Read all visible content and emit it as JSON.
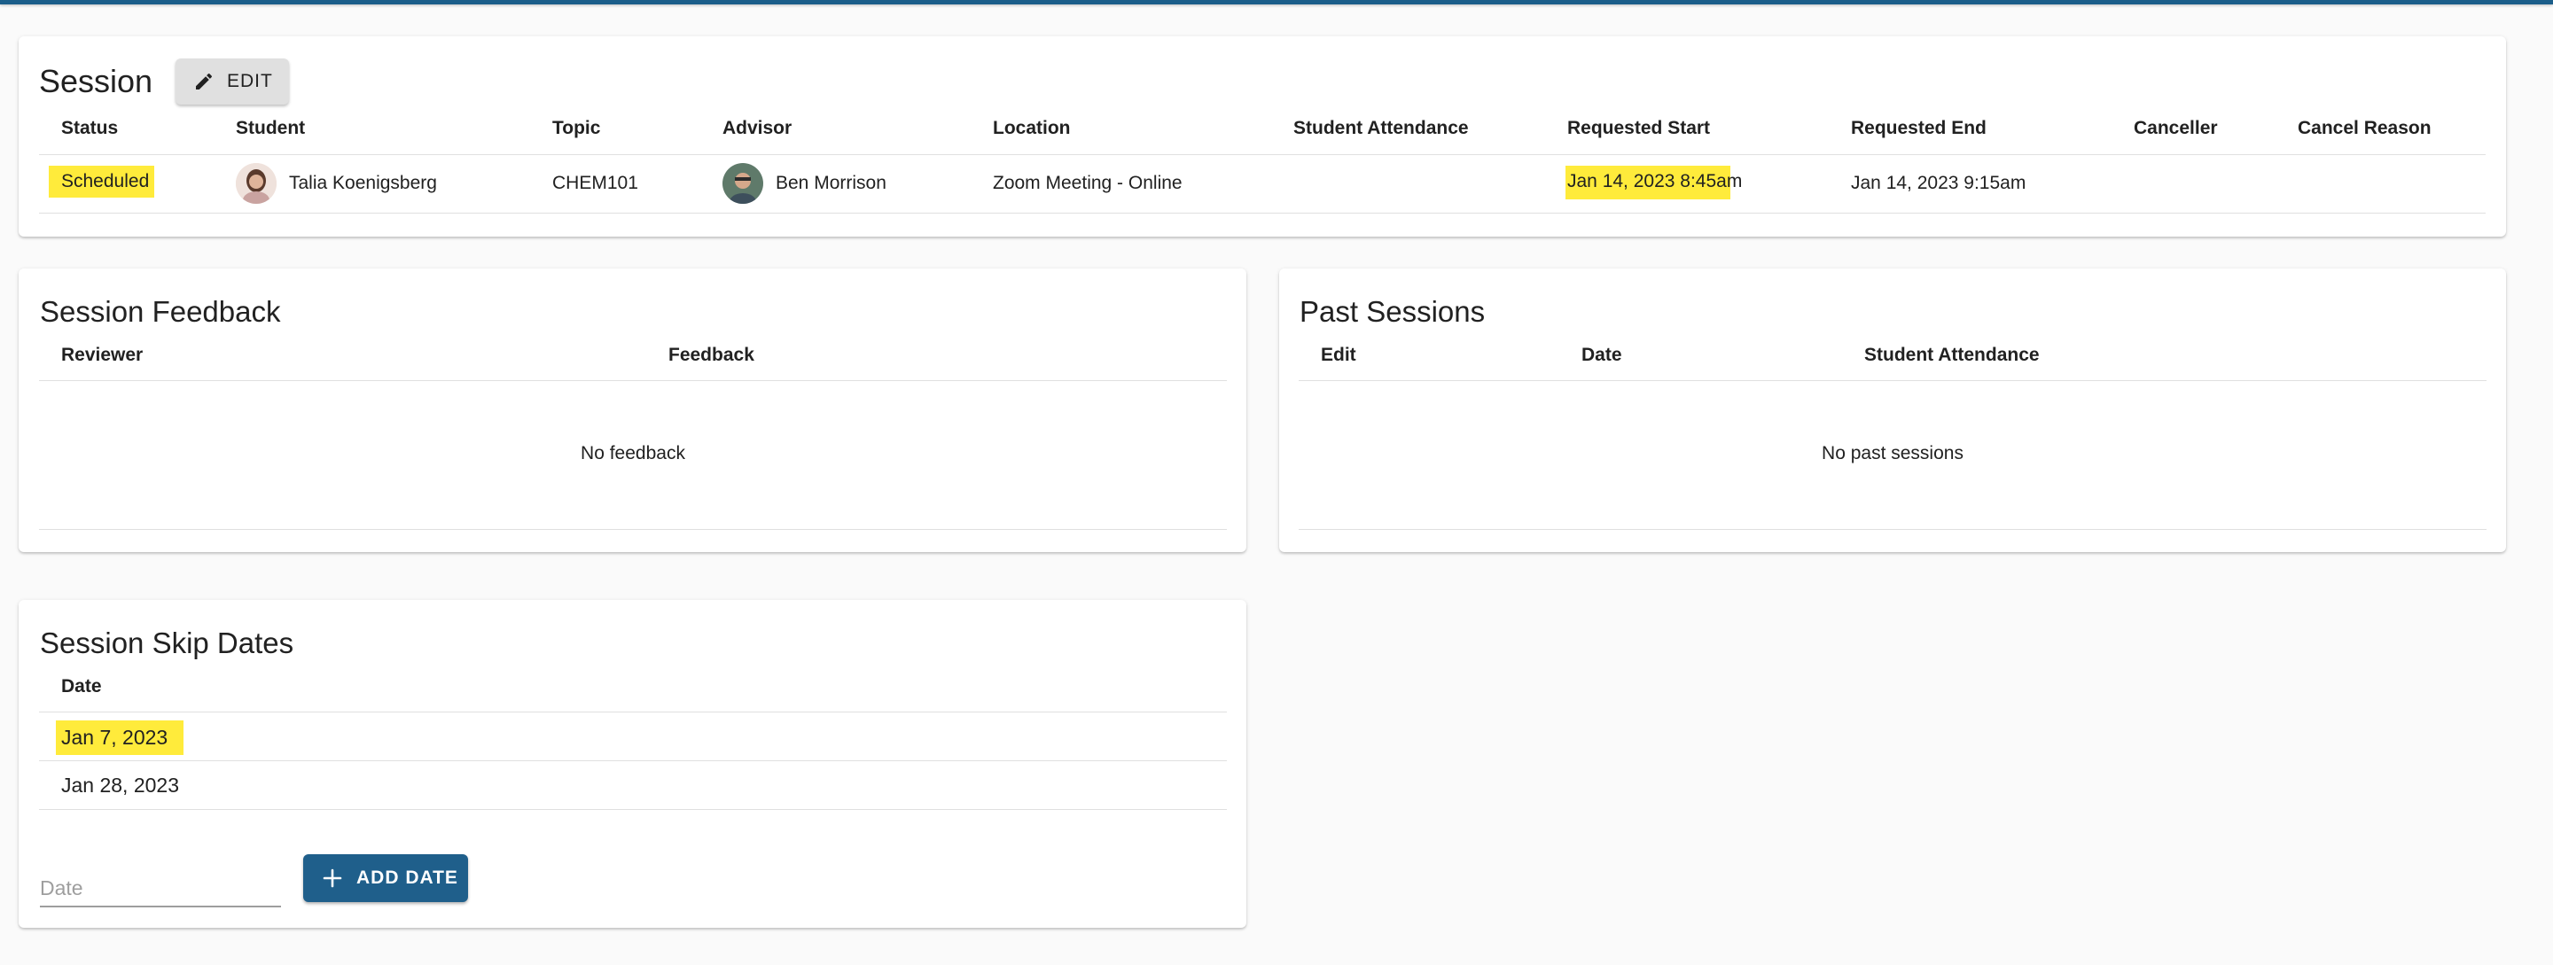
{
  "session": {
    "title": "Session",
    "edit_label": "EDIT",
    "columns": [
      "Status",
      "Student",
      "Topic",
      "Advisor",
      "Location",
      "Student Attendance",
      "Requested Start",
      "Requested End",
      "Canceller",
      "Cancel Reason"
    ],
    "row": {
      "status": "Scheduled",
      "student": "Talia Koenigsberg",
      "topic": "CHEM101",
      "advisor": "Ben Morrison",
      "location": "Zoom Meeting - Online",
      "student_attendance": "",
      "requested_start": "Jan 14, 2023 8:45am",
      "requested_end": "Jan 14, 2023 9:15am",
      "canceller": "",
      "cancel_reason": ""
    }
  },
  "feedback": {
    "title": "Session Feedback",
    "columns": [
      "Reviewer",
      "Feedback"
    ],
    "empty": "No feedback"
  },
  "past_sessions": {
    "title": "Past Sessions",
    "columns": [
      "Edit",
      "Date",
      "Student Attendance"
    ],
    "empty": "No past sessions"
  },
  "skip_dates": {
    "title": "Session Skip Dates",
    "column": "Date",
    "rows": [
      "Jan 7, 2023",
      "Jan 28, 2023"
    ],
    "input_placeholder": "Date",
    "add_label": "ADD DATE"
  },
  "colors": {
    "accent": "#1f5f8b",
    "highlight": "#ffeb3b"
  },
  "icons": {
    "edit": "pencil-icon",
    "add": "plus-icon"
  }
}
